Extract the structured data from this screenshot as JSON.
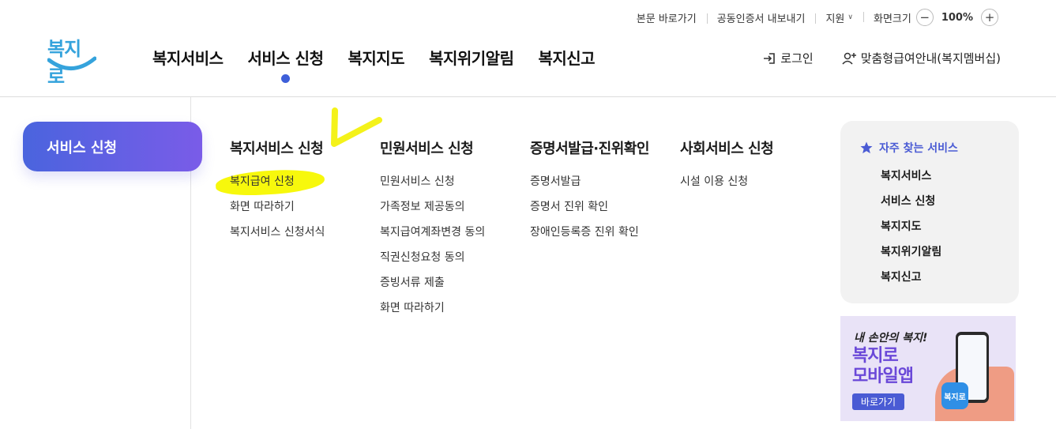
{
  "utility": {
    "skip_to_content": "본문 바로가기",
    "cert_export": "공동인증서 내보내기",
    "support": "지원",
    "zoom_label": "화면크기",
    "zoom_value": "100%",
    "zoom_out": "−",
    "zoom_in": "+"
  },
  "logo": {
    "text": "복지로"
  },
  "gnb": [
    {
      "label": "복지서비스"
    },
    {
      "label": "서비스 신청"
    },
    {
      "label": "복지지도"
    },
    {
      "label": "복지위기알림"
    },
    {
      "label": "복지신고"
    }
  ],
  "header_right": {
    "login": "로그인",
    "membership": "맞춤형급여안내(복지멤버십)"
  },
  "side": {
    "active_label": "서비스 신청"
  },
  "columns": [
    {
      "title": "복지서비스 신청",
      "links": [
        "복지급여 신청",
        "화면 따라하기",
        "복지서비스 신청서식"
      ]
    },
    {
      "title": "민원서비스 신청",
      "links": [
        "민원서비스 신청",
        "가족정보 제공동의",
        "복지급여계좌변경 동의",
        "직권신청요청 동의",
        "증빙서류 제출",
        "화면 따라하기"
      ]
    },
    {
      "title": "증명서발급·진위확인",
      "links": [
        "증명서발급",
        "증명서 진위 확인",
        "장애인등록증 진위 확인"
      ]
    },
    {
      "title": "사회서비스 신청",
      "links": [
        "시설 이용 신청"
      ]
    }
  ],
  "favorites": {
    "title": "자주 찾는 서비스",
    "items": [
      "복지서비스",
      "서비스 신청",
      "복지지도",
      "복지위기알림",
      "복지신고"
    ]
  },
  "banner": {
    "tagline": "내 손안의 복지!",
    "line1": "복지로",
    "line2": "모바일앱",
    "button": "바로가기",
    "app_text": "복지로"
  },
  "colors": {
    "accent": "#3e5fd9",
    "side_gradient_start": "#4a64de",
    "side_gradient_end": "#7a5ce8",
    "highlight": "#f7f80c"
  }
}
